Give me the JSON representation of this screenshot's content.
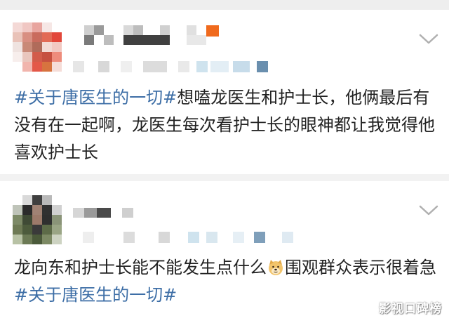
{
  "posts": [
    {
      "hashtag": "#关于唐医生的一切#",
      "text": "想嗑龙医生和护士长，他俩最后有没有在一起啊，龙医生每次看护士长的眼神都让我觉得他喜欢护士长"
    },
    {
      "text_before": "龙向东和护士长能不能发生点什么",
      "emoji": "doge-emoji",
      "text_after": "围观群众表示很着急",
      "hashtag": "#关于唐医生的一切#"
    }
  ],
  "watermark": "影视口碑榜",
  "colors": {
    "hashtag": "#3d6ea6",
    "text": "#222222",
    "chevron": "#b0b0b0",
    "background": "#f2f2f2"
  }
}
